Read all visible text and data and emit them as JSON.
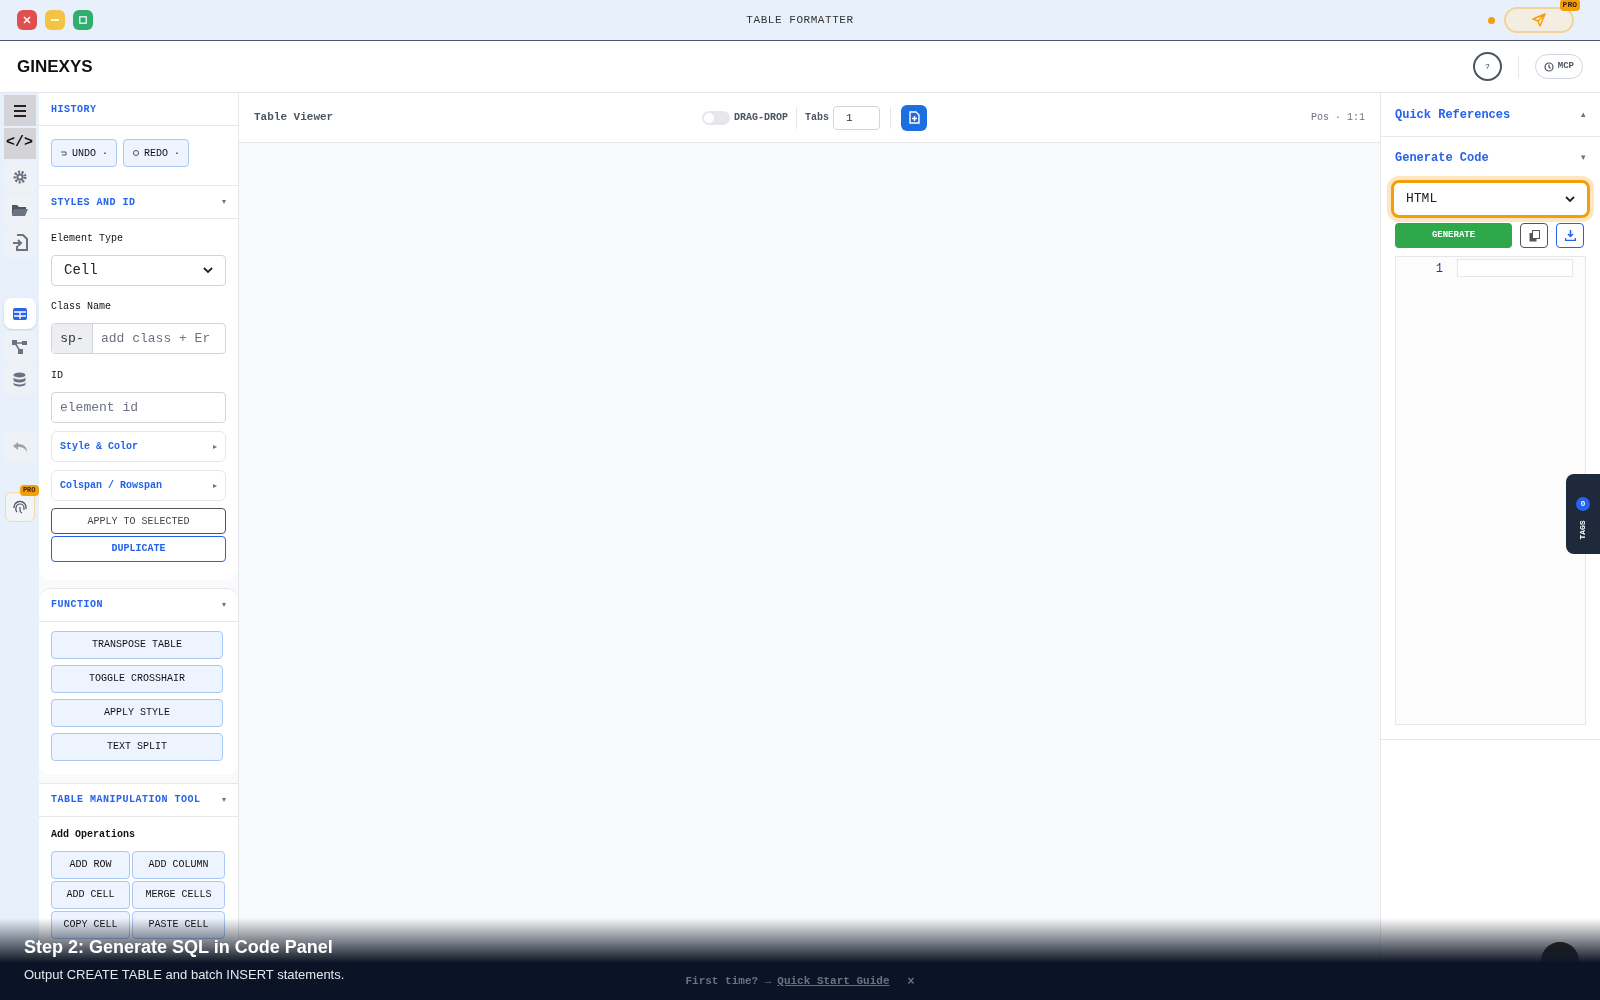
{
  "window": {
    "title": "TABLE FORMATTER",
    "pro_badge": "PRO",
    "status_dot": true
  },
  "header": {
    "brand": "GINEXYS",
    "help": "?",
    "mcp": "MCP"
  },
  "rail": [
    {
      "kind": "menu",
      "selected": false
    },
    {
      "kind": "code",
      "selected": false,
      "glyph": "</>"
    },
    {
      "kind": "gear",
      "selected": false
    },
    {
      "kind": "folder",
      "selected": false
    },
    {
      "kind": "import",
      "selected": false
    },
    {
      "kind": "table",
      "selected": true
    },
    {
      "kind": "graph",
      "selected": false
    },
    {
      "kind": "database",
      "selected": false
    },
    {
      "kind": "undo",
      "selected": false
    },
    {
      "kind": "fingerprint",
      "selected": false,
      "badge": "PRO"
    }
  ],
  "history": {
    "title": "HISTORY",
    "buttons": [
      "UNDO ·",
      "REDO ·"
    ]
  },
  "styles": {
    "title": "STYLES AND ID",
    "caret": "▾",
    "element_type_label": "Element Type",
    "element_type": "Cell",
    "class_label": "Class Name",
    "class_prefix": "sp-",
    "class_placeholder": "add class + Er",
    "id_label": "ID",
    "id_placeholder": "element id",
    "collapsibles": [
      {
        "label": "Style & Color",
        "caret": "▸"
      },
      {
        "label": "Colspan / Rowspan",
        "caret": "▸"
      }
    ],
    "apply": "APPLY TO SELECTED",
    "duplicate": "DUPLICATE"
  },
  "function": {
    "title": "FUNCTION",
    "caret": "▾",
    "buttons": [
      "TRANSPOSE TABLE",
      "TOGGLE CROSSHAIR",
      "APPLY STYLE",
      "TEXT SPLIT"
    ]
  },
  "table_tool": {
    "title": "TABLE MANIPULATION TOOL",
    "caret": "▾",
    "subheading": "Add Operations",
    "buttons": [
      "ADD ROW",
      "ADD COLUMN",
      "ADD CELL",
      "MERGE CELLS",
      "COPY CELL",
      "PASTE CELL"
    ]
  },
  "viewer": {
    "title": "Table Viewer",
    "drag_drop": {
      "label": "DRAG-DROP",
      "on": false
    },
    "tabs_label": "Tabs",
    "tabs_value": "1",
    "pos": "Pos · 1:1"
  },
  "right": {
    "quick_refs": "Quick References",
    "quick_caret": "▴",
    "generate_title": "Generate Code",
    "generate_caret": "▾",
    "language": "HTML",
    "language_focused": true,
    "generate": "GENERATE",
    "line_numbers": [
      "1"
    ]
  },
  "tags": {
    "count": "0",
    "label": "TAGS"
  },
  "footer": {
    "prompt": "First time? →",
    "link": "Quick Start Guide",
    "close": "×"
  },
  "caption": {
    "title": "Step 2: Generate SQL in Code Panel",
    "subtitle": "Output CREATE TABLE and batch INSERT statements."
  }
}
